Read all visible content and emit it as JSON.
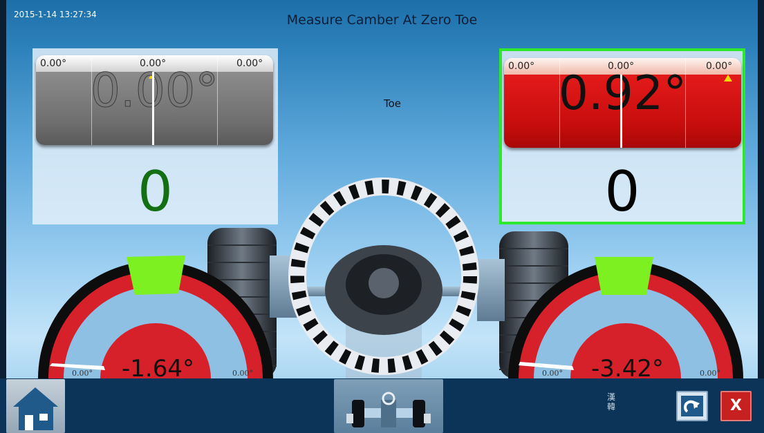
{
  "header": {
    "timestamp": "2015-1-14 13:27:34",
    "title": "Measure Camber At Zero Toe",
    "toe_label": "Toe"
  },
  "left_panel": {
    "scale": {
      "left": "0.00°",
      "center": "0.00°",
      "right": "0.00°"
    },
    "reading": "0.00°",
    "count": "0",
    "color": "#6e6e6e",
    "count_color": "#136f13"
  },
  "right_panel": {
    "scale": {
      "left": "0.00°",
      "center": "0.00°",
      "right": "0.00°"
    },
    "reading": "0.92°",
    "count": "0",
    "color": "#d11111",
    "selected_border_color": "#2ee82e"
  },
  "camber": {
    "left": {
      "value": "-1.64°",
      "tick_left": "0.00°",
      "tick_right": "0.00°"
    },
    "right": {
      "value": "-3.42°",
      "tick_left": "0.00°",
      "tick_right": "0.00°"
    },
    "zone_color": "#7df021",
    "ring_color": "#d6212b"
  },
  "toolbar": {
    "home_icon": "house-icon",
    "vehicle_icon": "vehicle-alignment-icon",
    "language_label": "漢\n韓",
    "back_icon": "back-arrow-icon",
    "close_label": "X"
  }
}
